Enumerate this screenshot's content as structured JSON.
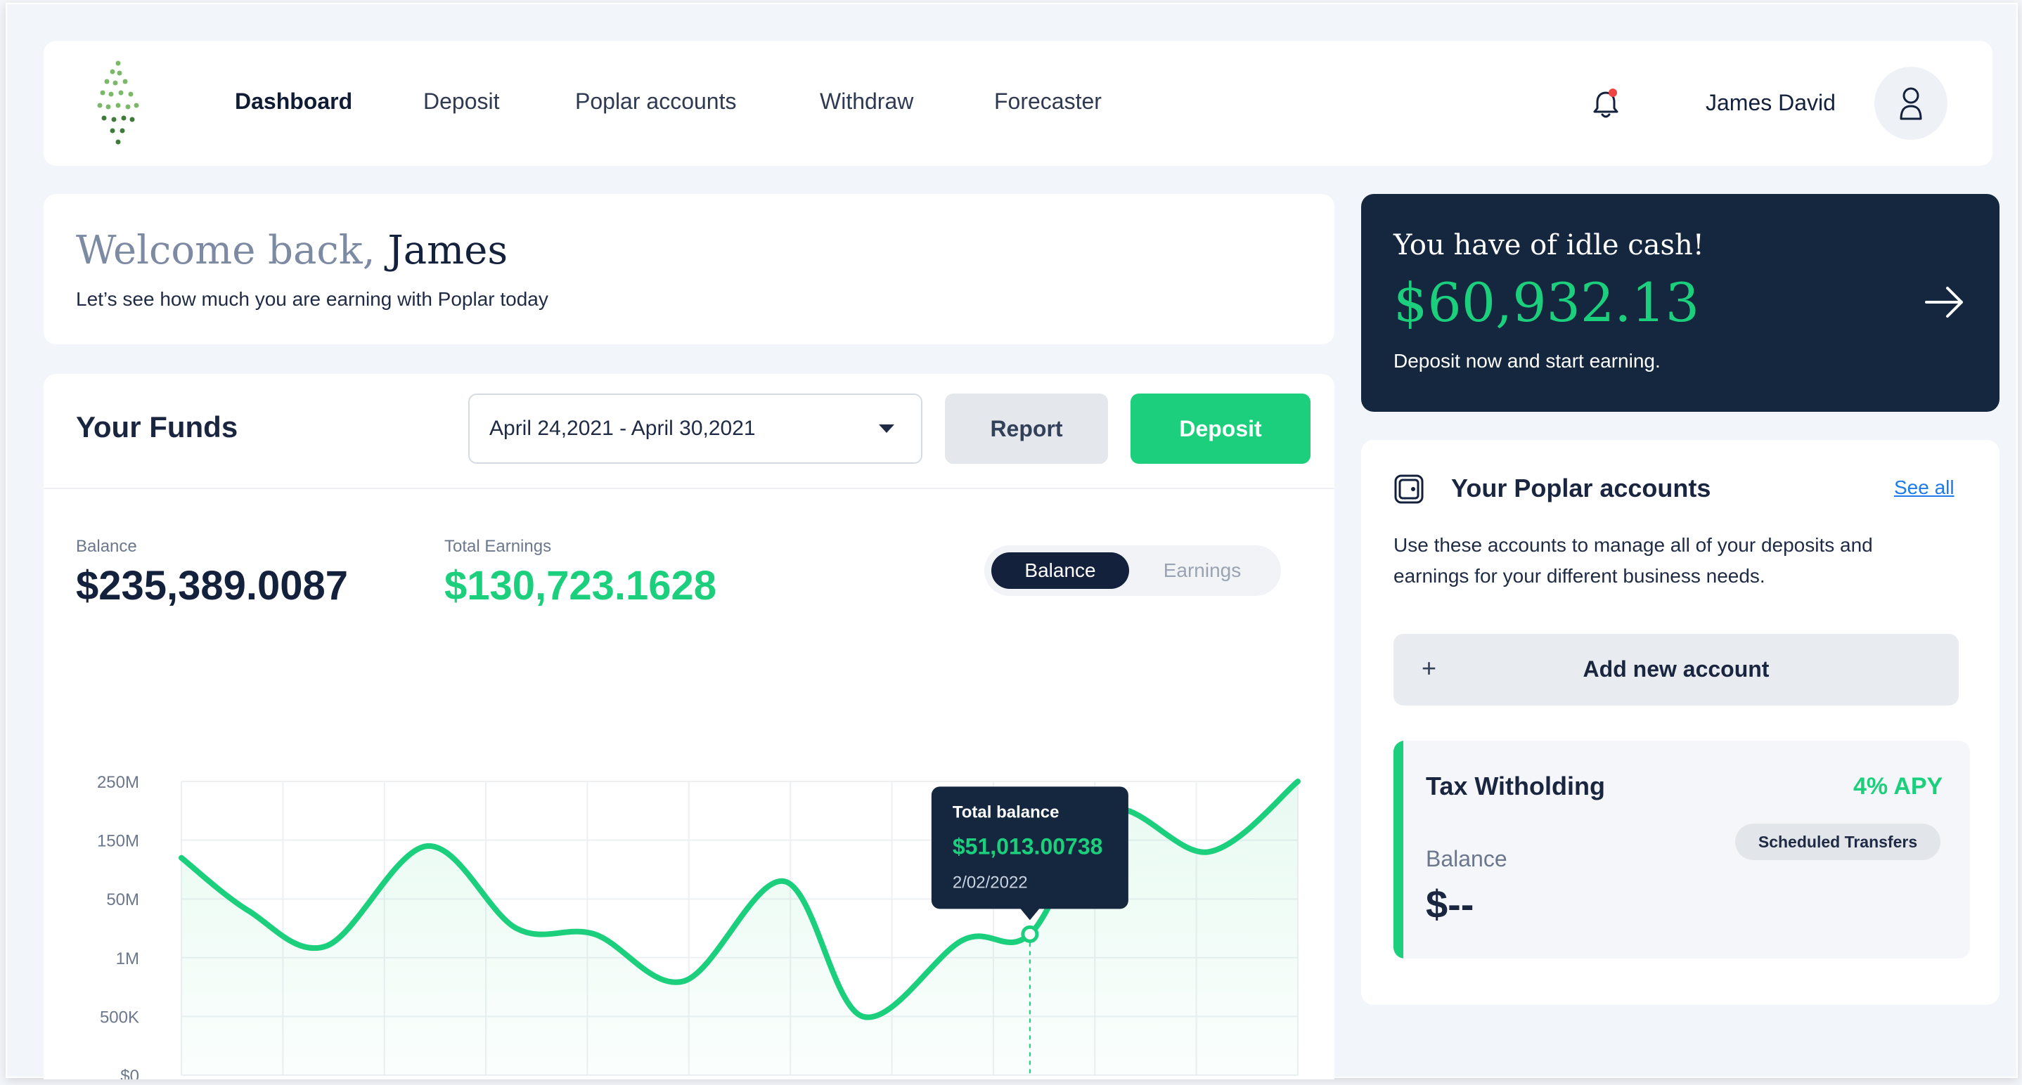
{
  "nav": {
    "items": [
      "Dashboard",
      "Deposit",
      "Poplar accounts",
      "Withdraw",
      "Forecaster"
    ],
    "active": "Dashboard"
  },
  "user": {
    "name": "James David",
    "has_notification": true
  },
  "welcome": {
    "greeting": "Welcome back,",
    "name": "James",
    "subtitle": "Let’s see how much you are earning with Poplar today"
  },
  "funds": {
    "title": "Your Funds",
    "date_range": "April 24,2021 - April 30,2021",
    "report_label": "Report",
    "deposit_label": "Deposit",
    "balance_label": "Balance",
    "balance_value": "$235,389.0087",
    "earnings_label": "Total Earnings",
    "earnings_value": "$130,723.1628",
    "toggle": {
      "options": [
        "Balance",
        "Earnings"
      ],
      "selected": "Balance"
    }
  },
  "idle_cash": {
    "title": "You have of idle cash!",
    "amount": "$60,932.13",
    "subtitle": "Deposit now and start earning."
  },
  "accounts": {
    "title": "Your Poplar accounts",
    "see_all": "See all",
    "description": "Use these accounts to manage all of your deposits and earnings for your different business needs.",
    "add_label": "Add new account",
    "add_icon": "+",
    "items": [
      {
        "name": "Tax Witholding",
        "apy": "4% APY",
        "badge": "Scheduled Transfers",
        "balance_label": "Balance",
        "balance_value": "$--"
      }
    ]
  },
  "colors": {
    "accent_green": "#1ccf7c",
    "navy": "#14213d",
    "idle_card_bg": "#14273f",
    "link_blue": "#1e7bea"
  },
  "chart_data": {
    "type": "line",
    "y_ticks": [
      "250M",
      "150M",
      "50M",
      "1M",
      "500K",
      "$0"
    ],
    "grid": true,
    "points": [
      {
        "x": 0,
        "y": 3.7
      },
      {
        "x": 0.6,
        "y": 2.8
      },
      {
        "x": 1.3,
        "y": 2.2
      },
      {
        "x": 2.2,
        "y": 3.9
      },
      {
        "x": 3.0,
        "y": 2.5
      },
      {
        "x": 3.7,
        "y": 2.4
      },
      {
        "x": 4.5,
        "y": 1.6
      },
      {
        "x": 5.4,
        "y": 3.3
      },
      {
        "x": 6.1,
        "y": 1.0
      },
      {
        "x": 7.0,
        "y": 2.3
      },
      {
        "x": 7.6,
        "y": 2.4
      },
      {
        "x": 8.3,
        "y": 4.5
      },
      {
        "x": 9.2,
        "y": 3.8
      },
      {
        "x": 10.0,
        "y": 5.0
      }
    ],
    "tooltip": {
      "label": "Total balance",
      "value": "$51,013.00738",
      "date": "2/02/2022",
      "point_index": 10
    }
  }
}
